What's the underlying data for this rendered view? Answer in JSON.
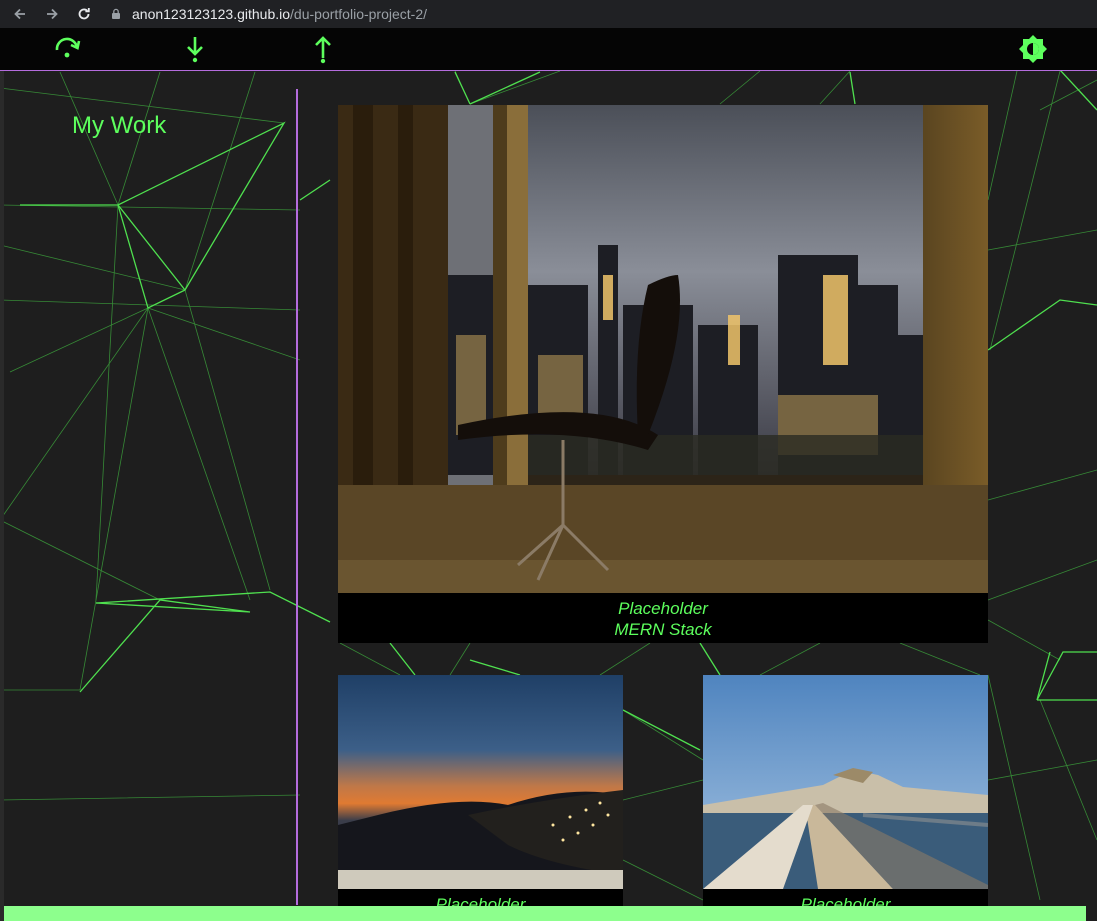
{
  "browser": {
    "url_host": "anon123123123.github.io",
    "url_path": "/du-portfolio-project-2/"
  },
  "nav": {
    "icons": [
      "redo-icon",
      "arrow-down-icon",
      "arrow-up-icon",
      "brightness-icon"
    ]
  },
  "page": {
    "title": "My Work"
  },
  "projects": [
    {
      "title": "Placeholder",
      "subtitle": "MERN Stack"
    },
    {
      "title": "Placeholder"
    },
    {
      "title": "Placeholder"
    }
  ],
  "colors": {
    "accent_green": "#5dff5d",
    "divider_purple": "#b46cdd",
    "background": "#1e1e1e",
    "bottom_bar": "#8dff8d"
  }
}
